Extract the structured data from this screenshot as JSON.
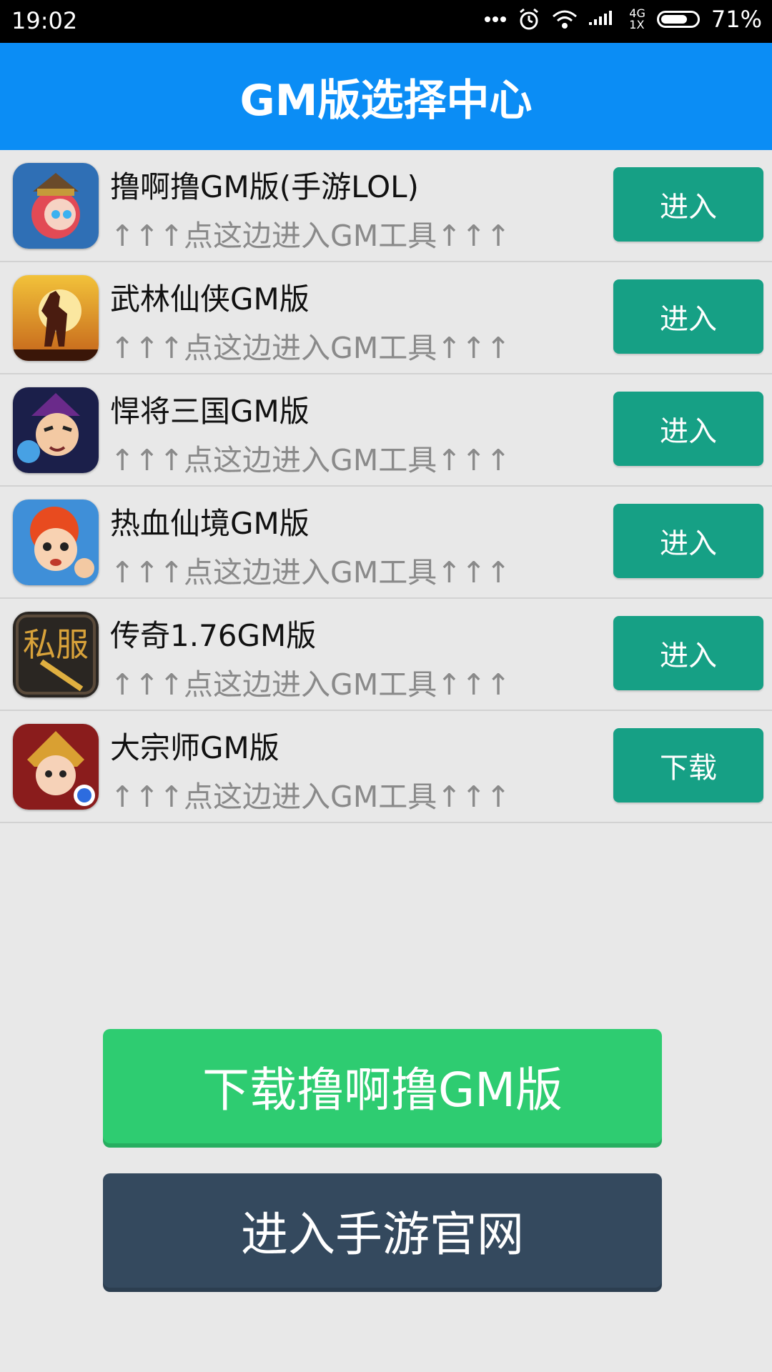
{
  "status_bar": {
    "time": "19:02",
    "network": "4G",
    "network_sub": "1X",
    "battery": "71%",
    "icons": [
      "more-dots-icon",
      "alarm-icon",
      "wifi-icon",
      "signal-icon",
      "battery-icon"
    ]
  },
  "header": {
    "title": "GM版选择中心",
    "color": "#0b8df5"
  },
  "games": [
    {
      "title": "撸啊撸GM版(手游LOL)",
      "subtitle": "↑↑↑点这边进入GM工具↑↑↑",
      "button": "进入",
      "icon": "lol-hero-icon"
    },
    {
      "title": "武林仙侠GM版",
      "subtitle": "↑↑↑点这边进入GM工具↑↑↑",
      "button": "进入",
      "icon": "swordsman-silhouette-icon"
    },
    {
      "title": "悍将三国GM版",
      "subtitle": "↑↑↑点这边进入GM工具↑↑↑",
      "button": "进入",
      "icon": "three-kingdoms-general-icon"
    },
    {
      "title": "热血仙境GM版",
      "subtitle": "↑↑↑点这边进入GM工具↑↑↑",
      "button": "进入",
      "icon": "cartoon-hero-icon"
    },
    {
      "title": "传奇1.76GM版",
      "subtitle": "↑↑↑点这边进入GM工具↑↑↑",
      "button": "进入",
      "icon": "sifu-calligraphy-icon",
      "icon_text": "私服"
    },
    {
      "title": "大宗师GM版",
      "subtitle": "↑↑↑点这边进入GM工具↑↑↑",
      "button": "下载",
      "icon": "grandmaster-warrior-icon"
    }
  ],
  "actions": {
    "download_label": "下载撸啊撸GM版",
    "website_label": "进入手游官网"
  },
  "colors": {
    "row_button": "#16a085",
    "download_button": "#2ecc71",
    "website_button": "#34495e"
  }
}
